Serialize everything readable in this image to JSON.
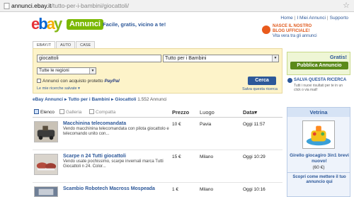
{
  "browser": {
    "url_host": "annunci.ebay.it",
    "url_path": "/tutto-per-i-bambini/giocattoli/"
  },
  "header": {
    "logo_text": "eBay",
    "logo_badge": "Annunci",
    "tagline": "Facile, gratis, vicino a te!",
    "toplinks": [
      "Home",
      "I Miei Annunci",
      "Supporto"
    ],
    "blog_line1": "NASCE IL NOSTRO",
    "blog_line2": "BLOG UFFICIALE!",
    "blog_line3": "Vita vera tra gli annunci"
  },
  "tabs": [
    "EBAY.IT",
    "AUTO",
    "CASE"
  ],
  "search": {
    "query": "giocattoli",
    "category": "Tutto per i Bambini",
    "region": "Tutte le regioni",
    "paypal_text": "Annunci con acquisto protetto",
    "paypal_brand": "PayPal",
    "saved_searches": "Le mie ricerche salvate ▾",
    "button": "Cerca",
    "save_search": "Salva questa ricerca"
  },
  "sidebar": {
    "gratis": "Gratis!",
    "publish_button": "Pubblica Annuncio",
    "save_title": "SALVA QUESTA RICERCA",
    "save_sub": "Tutti i nuovi risultati per te in un click o via mail!"
  },
  "breadcrumb": {
    "root": "eBay Annunci",
    "category": "Tutto per i Bambini",
    "subcategory": "Giocattoli",
    "count": "1.552 Annunci"
  },
  "views": [
    "Elenco",
    "Galleria",
    "Compatta"
  ],
  "columns": {
    "price": "Prezzo",
    "place": "Luogo",
    "date": "Data"
  },
  "listings": [
    {
      "title": "Macchinina telecomandata",
      "desc": "Vendo macchinina telecomandata con pilota giocattolo e telecomando unito con...",
      "price": "10 €",
      "place": "Pavia",
      "date": "Oggi 11:57"
    },
    {
      "title": "Scarpe n 24 Tutti giocattoli",
      "desc": "Vendo usate pochissimo, scarpe invernali marca Tutti Giocattoli n 24. Color...",
      "price": "15 €",
      "place": "Milano",
      "date": "Oggi 10:29"
    },
    {
      "title": "Scambio Robotech Macross Mospeada",
      "desc": "",
      "price": "1 €",
      "place": "Milano",
      "date": "Oggi 10:16"
    }
  ],
  "vetrina": {
    "title": "Vetrina",
    "item_title": "Girello giocagiro 3in1 brevi nuovo!",
    "item_price": "(60 €)",
    "link": "Scopri come mettere il tuo annuncio qui"
  }
}
